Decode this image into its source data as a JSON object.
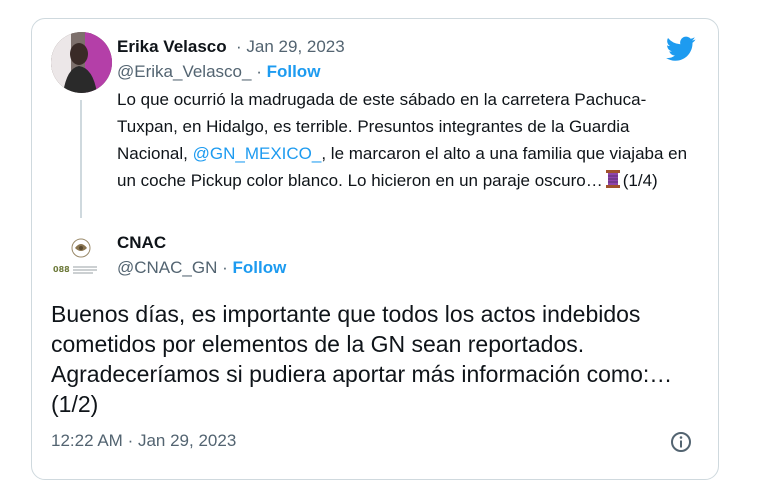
{
  "tweet": {
    "author_name": "Erika Velasco",
    "date": "Jan 29, 2023",
    "handle": "@Erika_Velasco_",
    "follow": "Follow",
    "text_before": "Lo que ocurrió la madrugada de este sábado en la carretera Pachuca-Tuxpan, en Hidalgo, es terrible. Presuntos integrantes de la Guardia Nacional, ",
    "mention": "@GN_MEXICO_",
    "text_after": ", le marcaron el alto a una familia que viajaba en un coche Pickup color blanco. Lo hicieron en un paraje oscuro…",
    "text_end": "(1/4)",
    "emoji_icon": "thread-spool-icon"
  },
  "reply": {
    "author_name": "CNAC",
    "handle": "@CNAC_GN",
    "follow": "Follow",
    "avatar_caption": "088",
    "text": "Buenos días, es importante que todos los actos indebidos cometidos por elementos de la GN sean reportados. Agradeceríamos si pudiera aportar más información como:… (1/2)",
    "time": "12:22 AM",
    "date": "Jan 29, 2023"
  },
  "colors": {
    "link": "#1d9bf0",
    "text": "#0f1419",
    "muted": "#536471",
    "border": "#cfd9de"
  },
  "icons": [
    "twitter-bird-icon",
    "info-icon"
  ]
}
